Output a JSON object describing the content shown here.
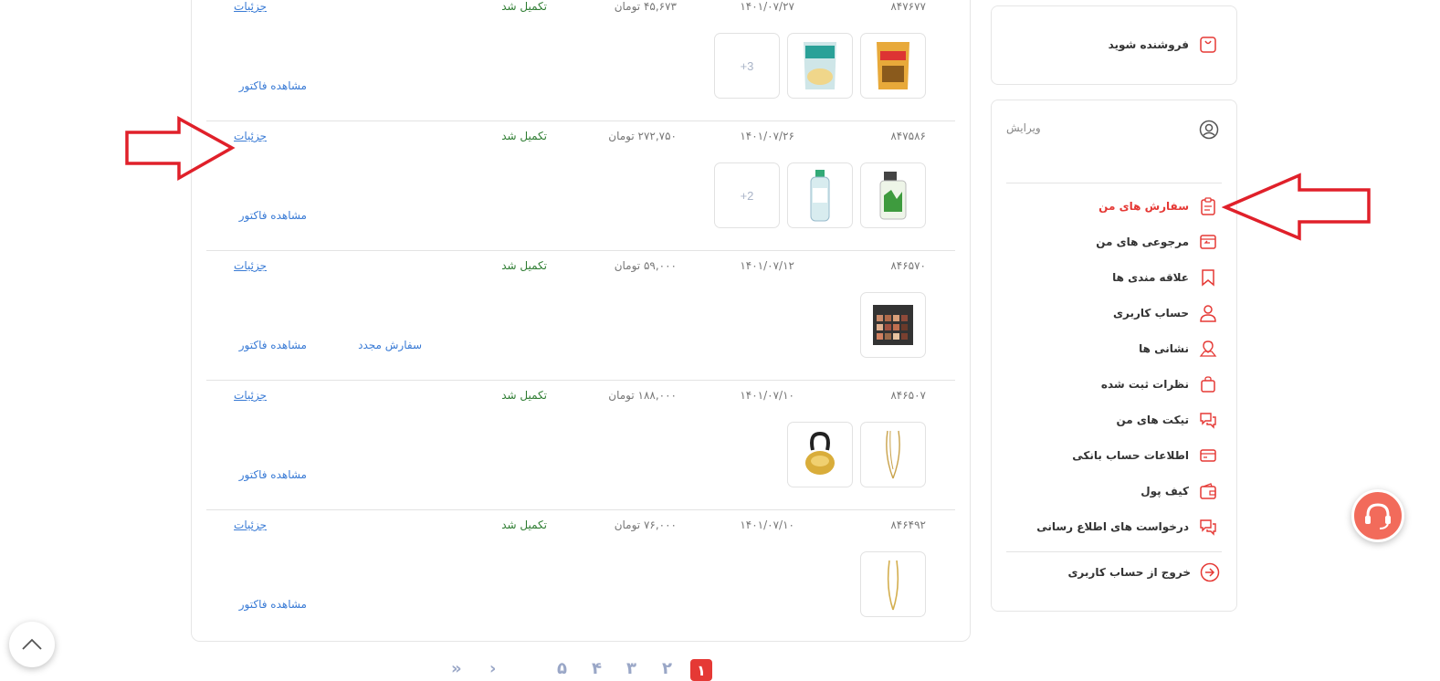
{
  "orders": [
    {
      "code": "۸۴۷۶۷۷",
      "date": "۱۴۰۱/۰۷/۲۷",
      "price": "۴۵,۶۷۳ تومان",
      "status": "تکمیل شد",
      "details": "جزئیات",
      "invoice": "مشاهده فاکتور",
      "more": "+3",
      "reorder": ""
    },
    {
      "code": "۸۴۷۵۸۶",
      "date": "۱۴۰۱/۰۷/۲۶",
      "price": "۲۷۲,۷۵۰ تومان",
      "status": "تکمیل شد",
      "details": "جزئیات",
      "invoice": "مشاهده فاکتور",
      "more": "+2",
      "reorder": ""
    },
    {
      "code": "۸۴۶۵۷۰",
      "date": "۱۴۰۱/۰۷/۱۲",
      "price": "۵۹,۰۰۰ تومان",
      "status": "تکمیل شد",
      "details": "جزئیات",
      "invoice": "مشاهده فاکتور",
      "more": "",
      "reorder": "سفارش مجدد"
    },
    {
      "code": "۸۴۶۵۰۷",
      "date": "۱۴۰۱/۰۷/۱۰",
      "price": "۱۸۸,۰۰۰ تومان",
      "status": "تکمیل شد",
      "details": "جزئیات",
      "invoice": "مشاهده فاکتور",
      "more": "",
      "reorder": ""
    },
    {
      "code": "۸۴۶۴۹۲",
      "date": "۱۴۰۱/۰۷/۱۰",
      "price": "۷۶,۰۰۰ تومان",
      "status": "تکمیل شد",
      "details": "جزئیات",
      "invoice": "مشاهده فاکتور",
      "more": "",
      "reorder": ""
    }
  ],
  "sidebar": {
    "become_seller": "فروشنده شوید",
    "edit": "ویرایش",
    "items": [
      {
        "label": "سفارش های من",
        "icon": "clipboard-icon",
        "active": true
      },
      {
        "label": "مرجوعی های من",
        "icon": "return-box-icon"
      },
      {
        "label": "علاقه مندی ها",
        "icon": "bookmark-icon"
      },
      {
        "label": "حساب کاربری",
        "icon": "user-icon"
      },
      {
        "label": "نشانی ها",
        "icon": "map-pin-icon"
      },
      {
        "label": "نظرات ثبت شده",
        "icon": "comment-bag-icon"
      },
      {
        "label": "تیکت های من",
        "icon": "chat-icon"
      },
      {
        "label": "اطلاعات حساب بانکی",
        "icon": "card-icon"
      },
      {
        "label": "کیف پول",
        "icon": "wallet-icon"
      },
      {
        "label": "درخواست های اطلاع رسانی",
        "icon": "chat-icon"
      }
    ],
    "logout": "خروج از حساب کاربری"
  },
  "pagination": {
    "pages": [
      "۱",
      "۲",
      "۳",
      "۴",
      "۵"
    ],
    "active": "۱",
    "next": "›",
    "last": "»"
  },
  "colors": {
    "accent": "#e53935",
    "link": "#3a7bd5",
    "status": "#2e7d32",
    "annotation": "#e0202a"
  }
}
